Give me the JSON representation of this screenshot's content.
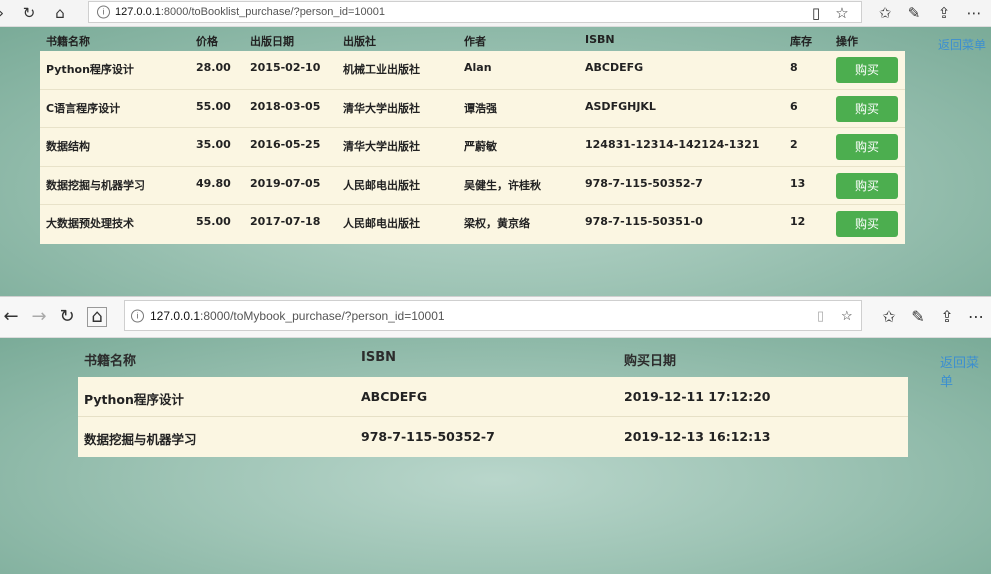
{
  "window1": {
    "url_host": "127.0.0.1",
    "url_path": ":8000/toBooklist_purchase/?person_id=10001",
    "back_link": "返回菜单",
    "headers": [
      "书籍名称",
      "价格",
      "出版日期",
      "出版社",
      "作者",
      "ISBN",
      "库存",
      "操作"
    ],
    "buy_label": "购买",
    "rows": [
      {
        "name": "Python程序设计",
        "price": "28.00",
        "date": "2015-02-10",
        "publisher": "机械工业出版社",
        "author": "Alan",
        "isbn": "ABCDEFG",
        "stock": "8"
      },
      {
        "name": "C语言程序设计",
        "price": "55.00",
        "date": "2018-03-05",
        "publisher": "清华大学出版社",
        "author": "谭浩强",
        "isbn": "ASDFGHJKL",
        "stock": "6"
      },
      {
        "name": "数据结构",
        "price": "35.00",
        "date": "2016-05-25",
        "publisher": "清华大学出版社",
        "author": "严蔚敏",
        "isbn": "124831-12314-142124-1321",
        "stock": "2"
      },
      {
        "name": "数据挖掘与机器学习",
        "price": "49.80",
        "date": "2019-07-05",
        "publisher": "人民邮电出版社",
        "author": "吴健生，许桂秋",
        "isbn": "978-7-115-50352-7",
        "stock": "13"
      },
      {
        "name": "大数据预处理技术",
        "price": "55.00",
        "date": "2017-07-18",
        "publisher": "人民邮电出版社",
        "author": "梁权，黄京络",
        "isbn": "978-7-115-50351-0",
        "stock": "12"
      }
    ]
  },
  "window2": {
    "url_host": "127.0.0.1",
    "url_path": ":8000/toMybook_purchase/?person_id=10001",
    "back_link": "返回菜单",
    "headers": [
      "书籍名称",
      "ISBN",
      "购买日期"
    ],
    "rows": [
      {
        "name": "Python程序设计",
        "isbn": "ABCDEFG",
        "date": "2019-12-11 17:12:20"
      },
      {
        "name": "数据挖掘与机器学习",
        "isbn": "978-7-115-50352-7",
        "date": "2019-12-13 16:12:13"
      }
    ]
  }
}
